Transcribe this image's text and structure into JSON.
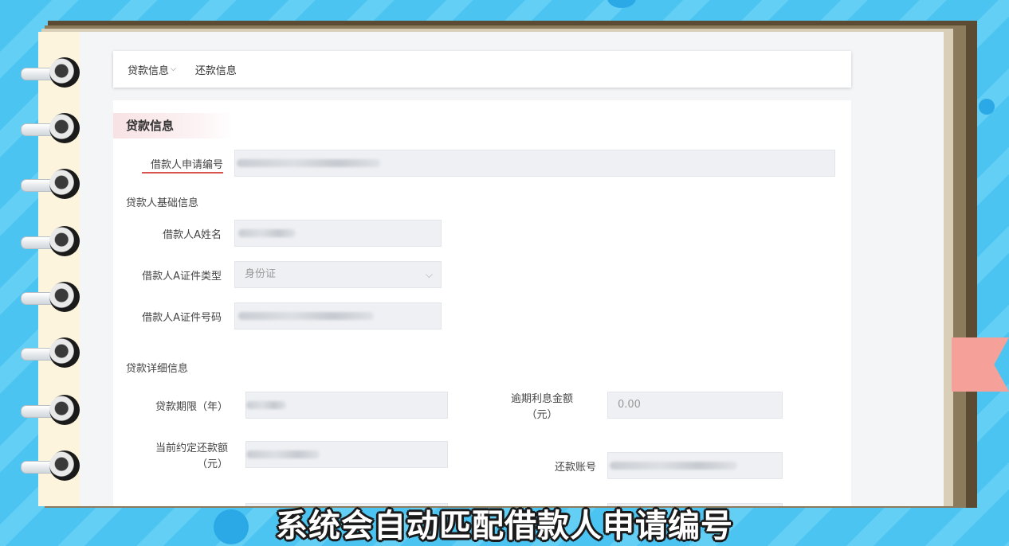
{
  "topnav": {
    "items": [
      {
        "label": "贷款信息",
        "has_caret": true
      },
      {
        "label": "还款信息",
        "has_caret": false
      }
    ]
  },
  "form": {
    "section_title": "贷款信息",
    "application_no": {
      "label": "借款人申请编号"
    },
    "basic_info_heading": "贷款人基础信息",
    "borrower_name": {
      "label": "借款人A姓名"
    },
    "id_type": {
      "label": "借款人A证件类型",
      "value": "身份证"
    },
    "id_number": {
      "label": "借款人A证件号码"
    },
    "detail_heading": "贷款详细信息",
    "loan_term": {
      "label": "贷款期限（年）"
    },
    "overdue_interest": {
      "label_line1": "逾期利息金额",
      "label_line2": "（元）",
      "value": "0.00"
    },
    "current_repayment": {
      "label_line1": "当前约定还款额",
      "label_line2": "（元）"
    },
    "repayment_account": {
      "label": "还款账号"
    }
  },
  "caption": "系统会自动匹配借款人申请编号",
  "colors": {
    "accent_red": "#d9534f",
    "ribbon": "#f6a09a",
    "background": "#4cc4f2"
  }
}
